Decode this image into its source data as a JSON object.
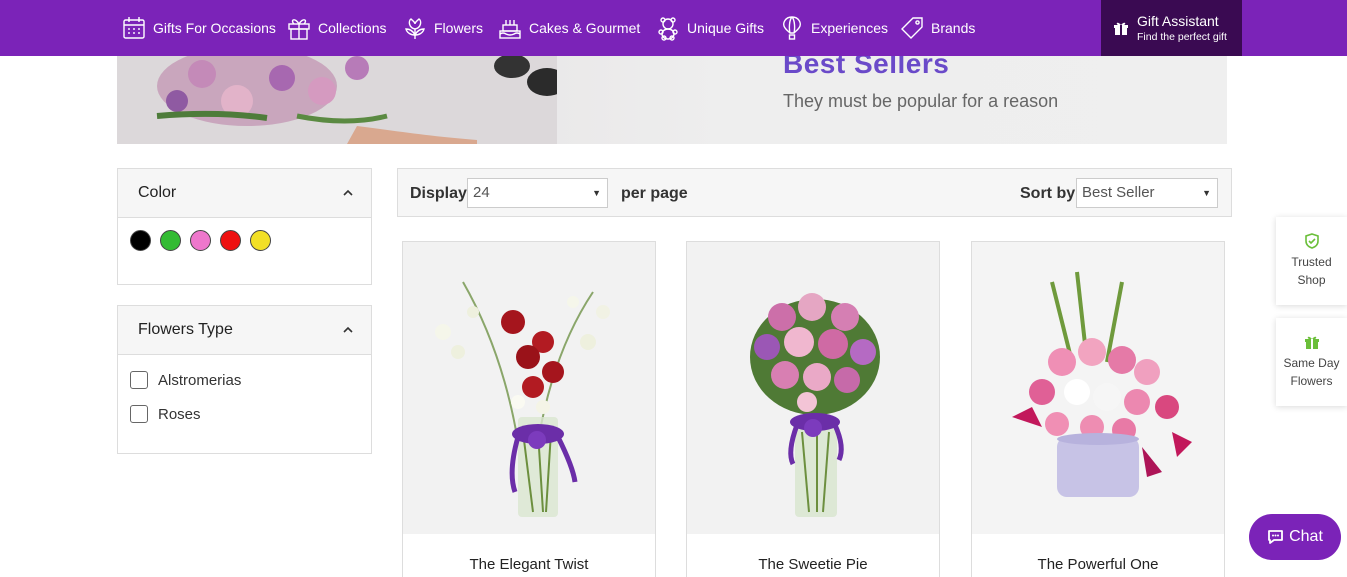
{
  "nav": {
    "items": [
      {
        "label": "Gifts For Occasions",
        "icon": "calendar-icon"
      },
      {
        "label": "Collections",
        "icon": "gift-box-icon"
      },
      {
        "label": "Flowers",
        "icon": "flower-icon"
      },
      {
        "label": "Cakes & Gourmet",
        "icon": "cake-icon"
      },
      {
        "label": "Unique Gifts",
        "icon": "teddy-bear-icon"
      },
      {
        "label": "Experiences",
        "icon": "hot-air-balloon-icon"
      },
      {
        "label": "Brands",
        "icon": "tag-icon"
      }
    ],
    "gift_assistant": {
      "title": "Gift Assistant",
      "subtitle": "Find the perfect gift",
      "icon": "gift-icon"
    }
  },
  "banner": {
    "title": "Best Sellers",
    "subtitle": "They must be popular for a reason"
  },
  "filters": {
    "color": {
      "title": "Color",
      "swatches": [
        "#000000",
        "#33bb33",
        "#ee77cc",
        "#ee1111",
        "#f2e026"
      ]
    },
    "flowers_type": {
      "title": "Flowers Type",
      "options": [
        "Alstromerias",
        "Roses"
      ]
    }
  },
  "toolbar": {
    "display_label": "Display",
    "per_page_value": "24",
    "per_page_label": "per page",
    "sort_label": "Sort by",
    "sort_value": "Best Seller"
  },
  "products": [
    {
      "name": "The Elegant Twist"
    },
    {
      "name": "The Sweetie Pie"
    },
    {
      "name": "The Powerful One"
    }
  ],
  "side_badges": [
    {
      "label_line1": "Trusted",
      "label_line2": "Shop",
      "icon": "shield-check-icon"
    },
    {
      "label_line1": "Same Day",
      "label_line2": "Flowers",
      "icon": "gift-icon"
    }
  ],
  "chat": {
    "label": "Chat",
    "icon": "chat-bubble-icon"
  },
  "colors": {
    "brand": "#7b23b8",
    "assistant_bg": "#3a0a52",
    "accent_green": "#6bbf3a"
  }
}
